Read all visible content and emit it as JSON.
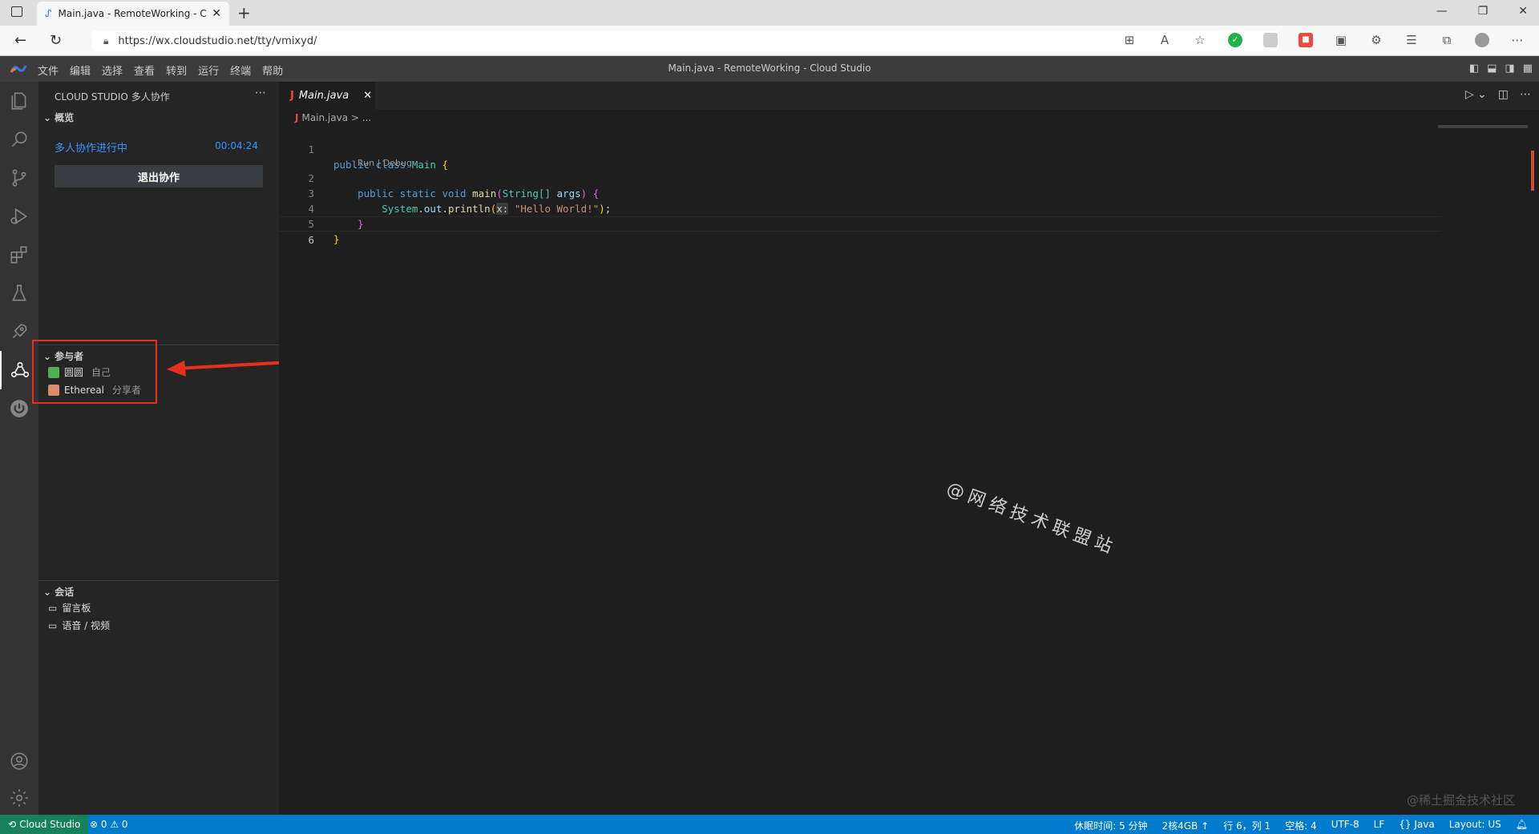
{
  "browser": {
    "tab_title": "Main.java - RemoteWorking - Cl",
    "url": "https://wx.cloudstudio.net/tty/vmixyd/"
  },
  "ide": {
    "window_title": "Main.java - RemoteWorking - Cloud Studio",
    "menu": [
      "文件",
      "编辑",
      "选择",
      "查看",
      "转到",
      "运行",
      "终端",
      "帮助"
    ]
  },
  "sidebar": {
    "title": "CLOUD STUDIO 多人协作",
    "overview_header": "概览",
    "collab_status": "多人协作进行中",
    "collab_time": "00:04:24",
    "exit_button": "退出协作",
    "participants_header": "参与者",
    "participants": [
      {
        "name": "圆圆",
        "role": "自己",
        "color": "#4caf50"
      },
      {
        "name": "Ethereal",
        "role": "分享者",
        "color": "#d98c6a"
      }
    ],
    "session_header": "会话",
    "session_items": [
      "留言板",
      "语音 / 视频"
    ]
  },
  "editor": {
    "tab_label": "Main.java",
    "breadcrumb": "Main.java > ...",
    "codelens": "Run | Debug",
    "line_numbers": [
      "1",
      "2",
      "3",
      "4",
      "5",
      "6"
    ],
    "code": {
      "l1_kw1": "public",
      "l1_kw2": "class",
      "l1_name": "Main",
      "l2_kw1": "public",
      "l2_kw2": "static",
      "l2_kw3": "void",
      "l2_fn": "main",
      "l2_type": "String[]",
      "l2_arg": "args",
      "l3_obj": "System",
      "l3_field": "out",
      "l3_fn": "println",
      "l3_hint": "x:",
      "l3_str": "\"Hello World!\""
    }
  },
  "watermark": "@网络技术联盟站",
  "bottom_watermark": "@稀土掘金技术社区",
  "statusbar": {
    "remote": "Cloud Studio",
    "problems": "⊗ 0 ⚠ 0",
    "items": [
      "休眠时间: 5 分钟",
      "2核4GB ↑",
      "行 6，列 1",
      "空格: 4",
      "UTF-8",
      "LF",
      "{} Java",
      "Layout: US"
    ]
  }
}
